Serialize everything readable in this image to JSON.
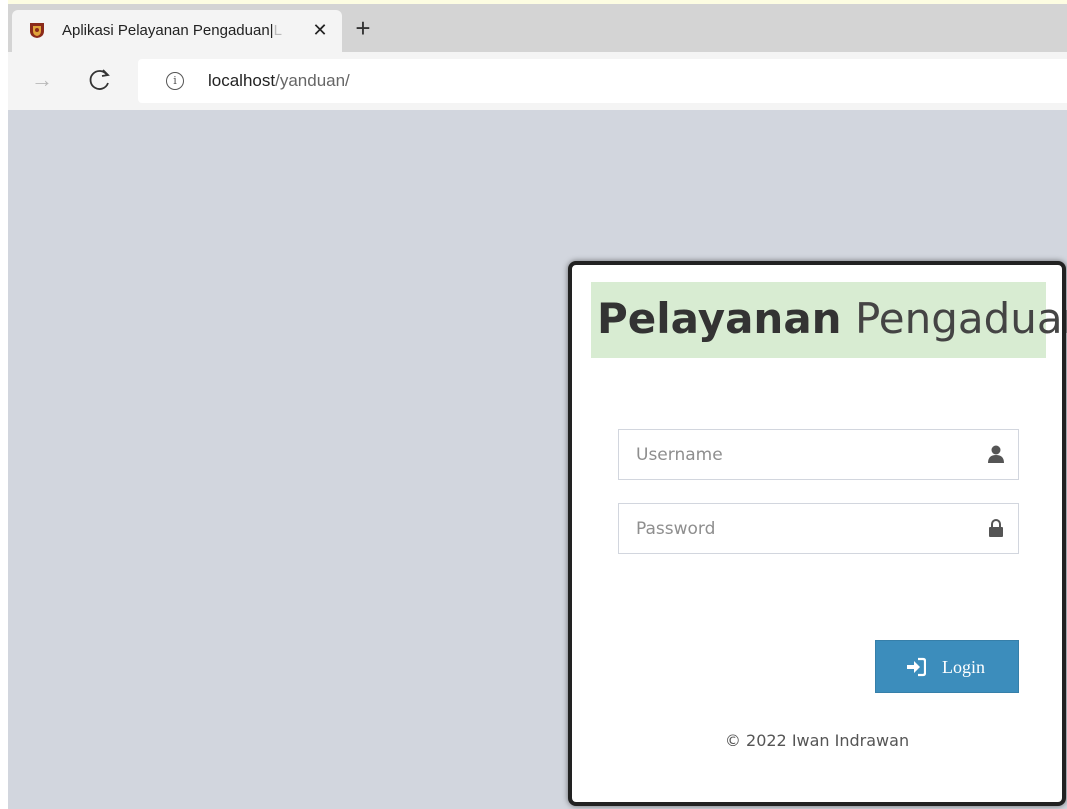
{
  "browser": {
    "tab": {
      "title": "Aplikasi Pelayanan Pengaduan|",
      "title_overflow": "L",
      "close_label": "✕"
    },
    "new_tab_label": "+",
    "address": {
      "host": "localhost",
      "path": "/yanduan/"
    }
  },
  "login": {
    "logo_bold": "Pelayanan",
    "logo_light": "Pengaduan",
    "username_placeholder": "Username",
    "password_placeholder": "Password",
    "button_label": "Login",
    "footer": "© 2022 Iwan Indrawan"
  },
  "colors": {
    "page_background": "#d2d6de",
    "logo_background": "#d8ecd2",
    "button_primary": "#3c8dbc"
  },
  "icons": {
    "username_field": "user-icon",
    "password_field": "lock-icon",
    "login_button": "sign-in-icon",
    "nav_forward": "arrow-right-icon",
    "nav_reload": "reload-icon",
    "address_info": "info-icon"
  }
}
